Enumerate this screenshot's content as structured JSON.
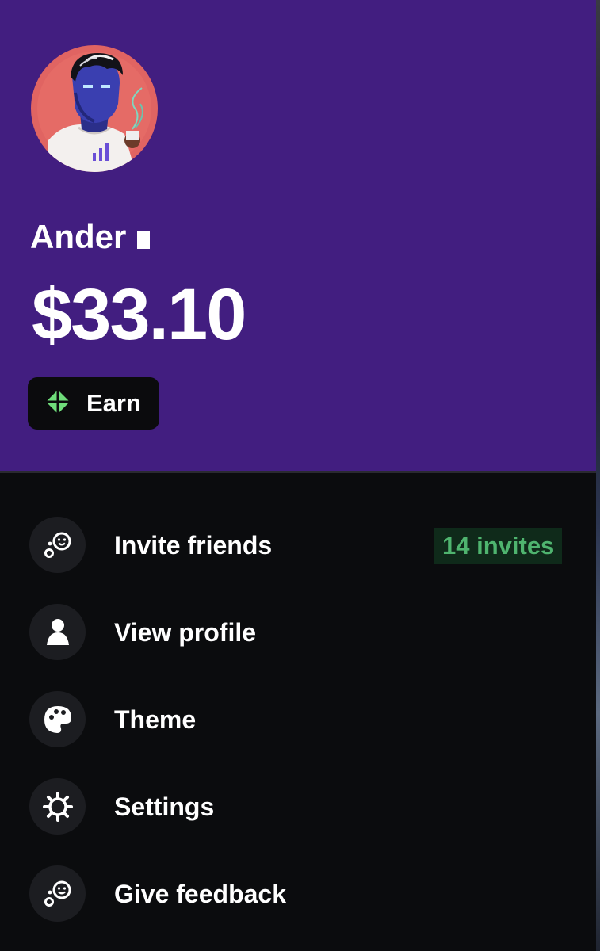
{
  "profile": {
    "name": "Ander",
    "balance": "$33.10",
    "avatar_alt": "profile-avatar"
  },
  "earn_button": {
    "label": "Earn",
    "icon": "diamond-icon",
    "icon_color": "#6fdc7a"
  },
  "menu": {
    "items": [
      {
        "label": "Invite friends",
        "icon": "friends-icon",
        "badge": "14 invites"
      },
      {
        "label": "View profile",
        "icon": "user-icon"
      },
      {
        "label": "Theme",
        "icon": "palette-icon"
      },
      {
        "label": "Settings",
        "icon": "gear-icon"
      },
      {
        "label": "Give feedback",
        "icon": "feedback-icon"
      }
    ]
  },
  "colors": {
    "header_bg": "#421e80",
    "panel_bg": "#0b0c0e",
    "badge_text": "#4fb46f",
    "badge_bg": "#0f2a1a"
  }
}
